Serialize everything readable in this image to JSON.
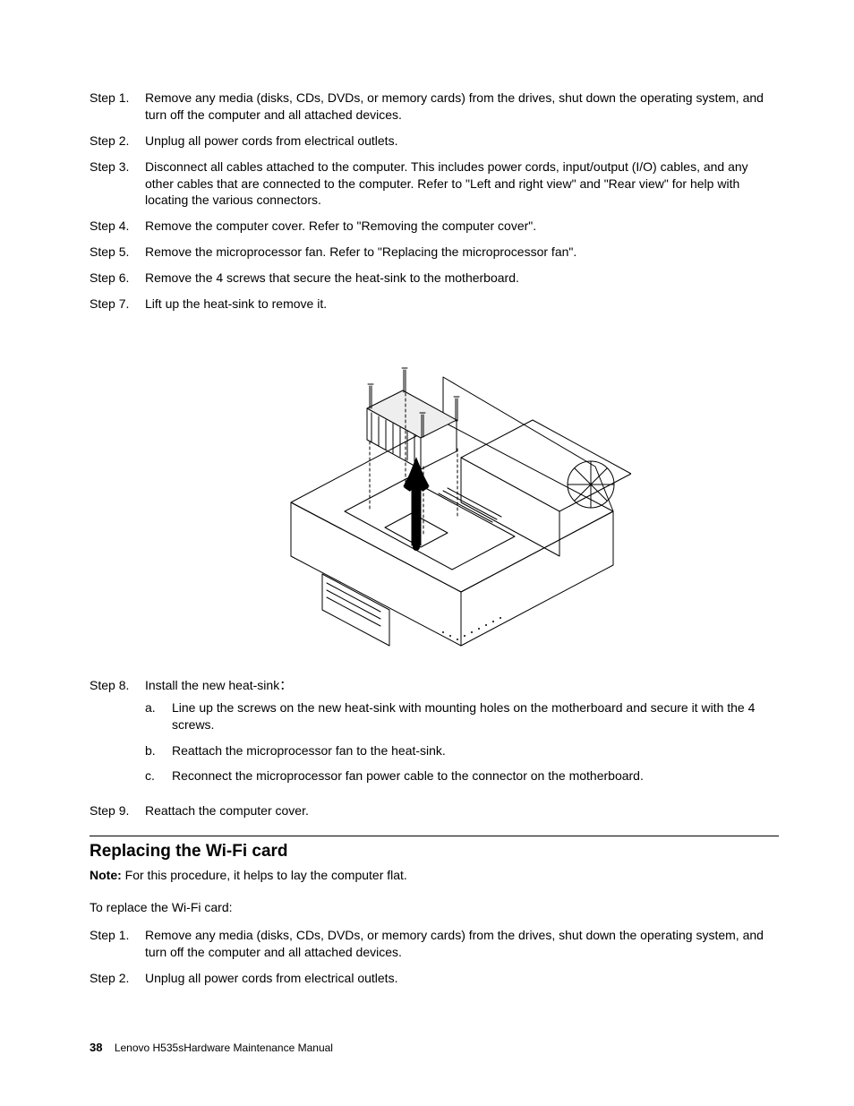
{
  "steps_a": [
    {
      "label": "Step 1.",
      "text": "Remove any media (disks, CDs, DVDs, or memory cards) from the drives, shut down the operating system, and turn off the computer and all attached devices."
    },
    {
      "label": "Step 2.",
      "text": "Unplug all power cords from electrical outlets."
    },
    {
      "label": "Step 3.",
      "text": "Disconnect all cables attached to the computer. This includes power cords, input/output (I/O) cables, and any other cables that are connected to the computer. Refer to \"Left and right view\" and \"Rear view\" for help with locating the various connectors."
    },
    {
      "label": "Step 4.",
      "text": "Remove the computer cover. Refer to \"Removing the computer cover\"."
    },
    {
      "label": "Step 5.",
      "text": "Remove the microprocessor fan. Refer to \"Replacing the microprocessor fan\"."
    },
    {
      "label": "Step 6.",
      "text": "Remove the 4 screws that secure the heat-sink to the motherboard."
    },
    {
      "label": "Step 7.",
      "text": "Lift up the heat-sink to remove it."
    }
  ],
  "step8": {
    "label": "Step 8.",
    "lead": "Install the new heat-sink：",
    "subs": [
      {
        "label": "a.",
        "text": "Line up the screws on the new heat-sink with mounting holes on the motherboard and secure it with the 4 screws."
      },
      {
        "label": "b.",
        "text": "Reattach the microprocessor fan to the heat-sink."
      },
      {
        "label": "c.",
        "text": "Reconnect the microprocessor fan power cable to the connector on the motherboard."
      }
    ]
  },
  "step9": {
    "label": "Step 9.",
    "text": "Reattach the computer cover."
  },
  "section": {
    "title": "Replacing the Wi-Fi card",
    "note_label": "Note:",
    "note_text": " For this procedure, it helps to lay the computer flat.",
    "intro": "To replace the Wi-Fi card:"
  },
  "steps_b": [
    {
      "label": "Step 1.",
      "text": "Remove any media (disks, CDs, DVDs, or memory cards) from the drives, shut down the operating system, and turn off the computer and all attached devices."
    },
    {
      "label": "Step 2.",
      "text": "Unplug all power cords from electrical outlets."
    }
  ],
  "footer": {
    "pagenum": "38",
    "doc": "Lenovo H535sHardware Maintenance Manual"
  }
}
